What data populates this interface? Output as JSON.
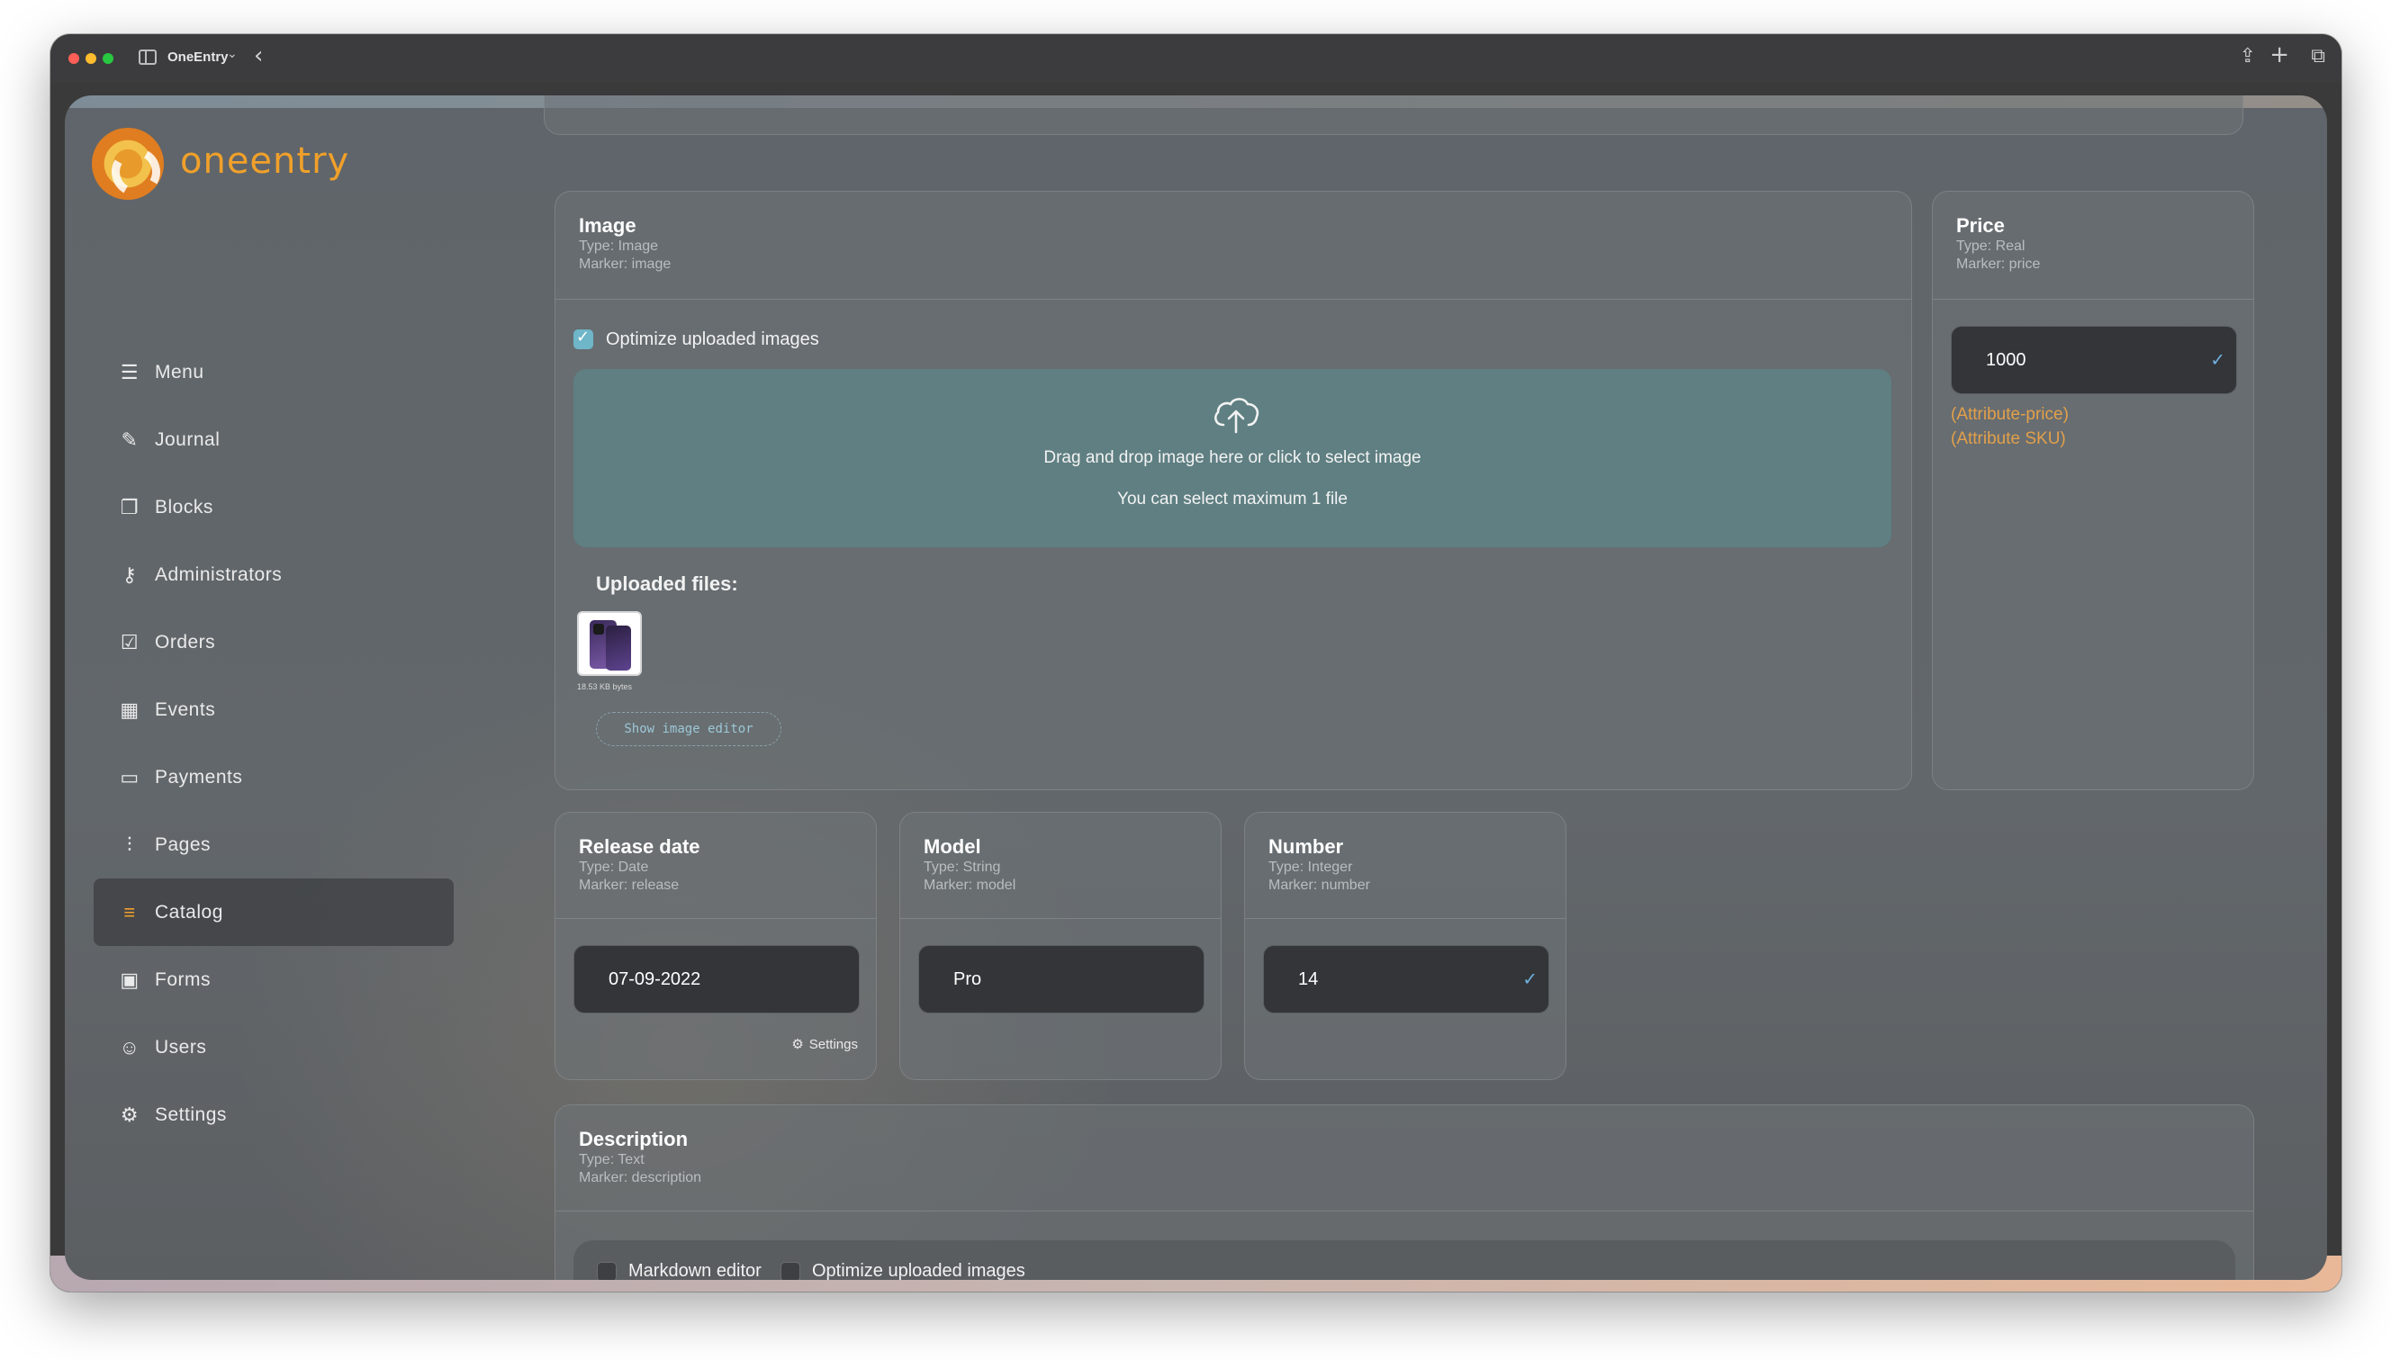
{
  "window": {
    "app_name": "OneEntry",
    "chevron": "⌄",
    "back": "‹"
  },
  "brand": {
    "logo_text": "oneentry",
    "logo_colors": [
      "#e07d20",
      "#f2c24c"
    ]
  },
  "sidebar": {
    "items": [
      {
        "label": "Menu",
        "icon": "menu-icon",
        "glyph": "☰",
        "active": false
      },
      {
        "label": "Journal",
        "icon": "journal-icon",
        "glyph": "✎",
        "active": false
      },
      {
        "label": "Blocks",
        "icon": "blocks-icon",
        "glyph": "❐",
        "active": false
      },
      {
        "label": "Administrators",
        "icon": "key-icon",
        "glyph": "⚷",
        "active": false
      },
      {
        "label": "Orders",
        "icon": "orders-icon",
        "glyph": "☑",
        "active": false
      },
      {
        "label": "Events",
        "icon": "calendar-icon",
        "glyph": "▦",
        "active": false
      },
      {
        "label": "Payments",
        "icon": "card-icon",
        "glyph": "▭",
        "active": false
      },
      {
        "label": "Pages",
        "icon": "sliders-icon",
        "glyph": "⫶",
        "active": false
      },
      {
        "label": "Catalog",
        "icon": "list-icon",
        "glyph": "≡",
        "active": true
      },
      {
        "label": "Forms",
        "icon": "forms-icon",
        "glyph": "▣",
        "active": false
      },
      {
        "label": "Users",
        "icon": "users-icon",
        "glyph": "☺",
        "active": false
      },
      {
        "label": "Settings",
        "icon": "gear-icon",
        "glyph": "⚙",
        "active": false
      }
    ],
    "accent_color": "#f0a02a"
  },
  "image_card": {
    "title": "Image",
    "type": "Type: Image",
    "marker": "Marker: image",
    "optimize_label": "Optimize uploaded images",
    "optimize_checked": true,
    "dropzone_line1": "Drag and drop image here or click to select image",
    "dropzone_line2": "You can select maximum 1 file",
    "uploaded_label": "Uploaded files:",
    "file_size": "18.53 KB bytes",
    "show_editor_label": "Show image editor"
  },
  "price_card": {
    "title": "Price",
    "type": "Type: Real",
    "marker": "Marker: price",
    "value": "1000",
    "link1": "(Attribute-price)",
    "link2": "(Attribute SKU)"
  },
  "release_card": {
    "title": "Release date",
    "type": "Type: Date",
    "marker": "Marker: release",
    "value": "07-09-2022",
    "settings_label": "Settings"
  },
  "model_card": {
    "title": "Model",
    "type": "Type: String",
    "marker": "Marker: model",
    "value": "Pro"
  },
  "number_card": {
    "title": "Number",
    "type": "Type: Integer",
    "marker": "Marker: number",
    "value": "14"
  },
  "description_card": {
    "title": "Description",
    "type": "Type: Text",
    "marker": "Marker: description",
    "markdown_label": "Markdown editor",
    "markdown_checked": false,
    "optimize_label": "Optimize uploaded images",
    "optimize_checked": false
  }
}
